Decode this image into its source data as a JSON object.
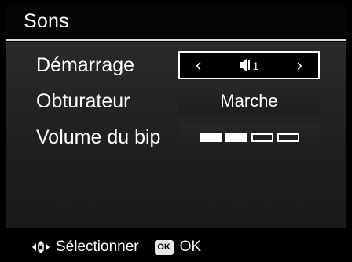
{
  "header": {
    "title": "Sons"
  },
  "menu": {
    "items": [
      {
        "label": "Démarrage",
        "value_icon": "speaker-icon",
        "value_suffix": "1",
        "left_arrow": "‹",
        "right_arrow": "›"
      },
      {
        "label": "Obturateur",
        "value": "Marche"
      },
      {
        "label": "Volume du bip",
        "volume_level": 2,
        "volume_max": 4
      }
    ]
  },
  "footer": {
    "nav_icon": "four-way-arrows-icon",
    "nav_label": "Sélectionner",
    "ok_badge": "OK",
    "ok_label": "OK"
  },
  "colors": {
    "background": "#000000",
    "text": "#ffffff",
    "panel": "#222222"
  }
}
